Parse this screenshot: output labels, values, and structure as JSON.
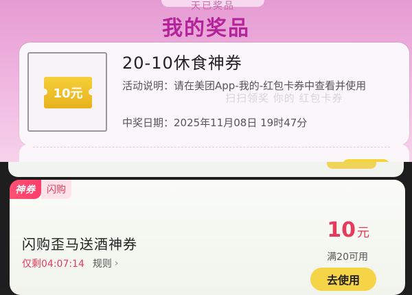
{
  "prize_panel": {
    "top_edge_text": "天已奖品",
    "title": "我的奖品",
    "voucher": {
      "amount_text": "10元"
    },
    "prize": {
      "name": "20-10休食神券",
      "description": "活动说明：请在美团App-我的-红包卡券中查看并使用",
      "date": "中奖日期：2025年11月08日 19时47分"
    },
    "watermark": "扫扫领奖 你的 红包卡券"
  },
  "coupon": {
    "tag_main": "神券",
    "tag_sub": "闪购",
    "title": "闪购歪马送酒神券",
    "countdown": "仅剩04:07:14",
    "rules_label": "规则",
    "amount": "10",
    "amount_unit": "元",
    "threshold": "满20可用",
    "use_button_label": "去使用"
  },
  "colors": {
    "brand_pink": "#b3239a",
    "accent_red": "#e63b5c",
    "button_yellow": "#f6d447",
    "voucher_gold": "#e6b21d"
  }
}
